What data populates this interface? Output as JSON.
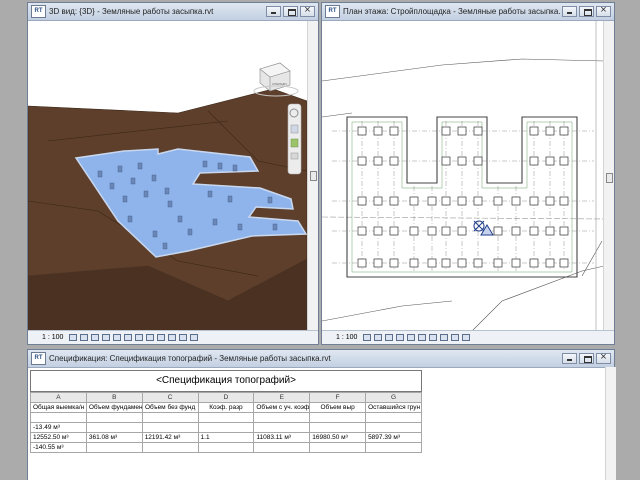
{
  "windows": {
    "view3d": {
      "title": "3D вид: {3D} - Земляные работы засыпка.rvt",
      "scale": "1 : 100",
      "viewcube_label": "СПЕРЕДИ"
    },
    "plan": {
      "title": "План этажа: Стройплощадка - Земляные работы засыпка.rvt",
      "scale": "1 : 100"
    },
    "schedule": {
      "title": "Спецификация: Спецификация топографий - Земляные работы засыпка.rvt",
      "heading": "<Спецификация топографий>",
      "column_letters": [
        "A",
        "B",
        "C",
        "D",
        "E",
        "F",
        "G"
      ],
      "columns": [
        "Общая выемка/н",
        "Объем фундамен",
        "Объем без фунд",
        "Коэф. разр",
        "Объем с уч. коэф",
        "Объем выр",
        "Оставшийся грун"
      ],
      "rows": [
        [
          "",
          "",
          "",
          "",
          "",
          "",
          ""
        ],
        [
          "-13.49 м³",
          "",
          "",
          "",
          "",
          "",
          ""
        ],
        [
          "12552.50 м³",
          "361.08 м³",
          "12191.42 м³",
          "1.1",
          "11083.11 м³",
          "16980.50 м³",
          "5897.39 м³"
        ],
        [
          "-140.55 м³",
          "",
          "",
          "",
          "",
          "",
          ""
        ]
      ]
    }
  },
  "colors": {
    "terrain": "#5e3f2b",
    "water": "#8fb4ec",
    "accent": "#2b4f86"
  }
}
